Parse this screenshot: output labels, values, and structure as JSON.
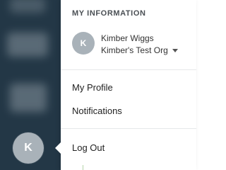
{
  "sidebar": {
    "avatar_initial": "K"
  },
  "menu": {
    "section_header": "MY INFORMATION",
    "user": {
      "initial": "K",
      "name": "Kimber Wiggs",
      "org": "Kimber's Test Org"
    },
    "items": [
      {
        "label": "My Profile"
      },
      {
        "label": "Notifications"
      },
      {
        "label": "Log Out"
      }
    ]
  },
  "colors": {
    "sidebar_bg": "#233746",
    "avatar_bg": "#a9b2b9",
    "menu_bg": "#ffffff"
  }
}
